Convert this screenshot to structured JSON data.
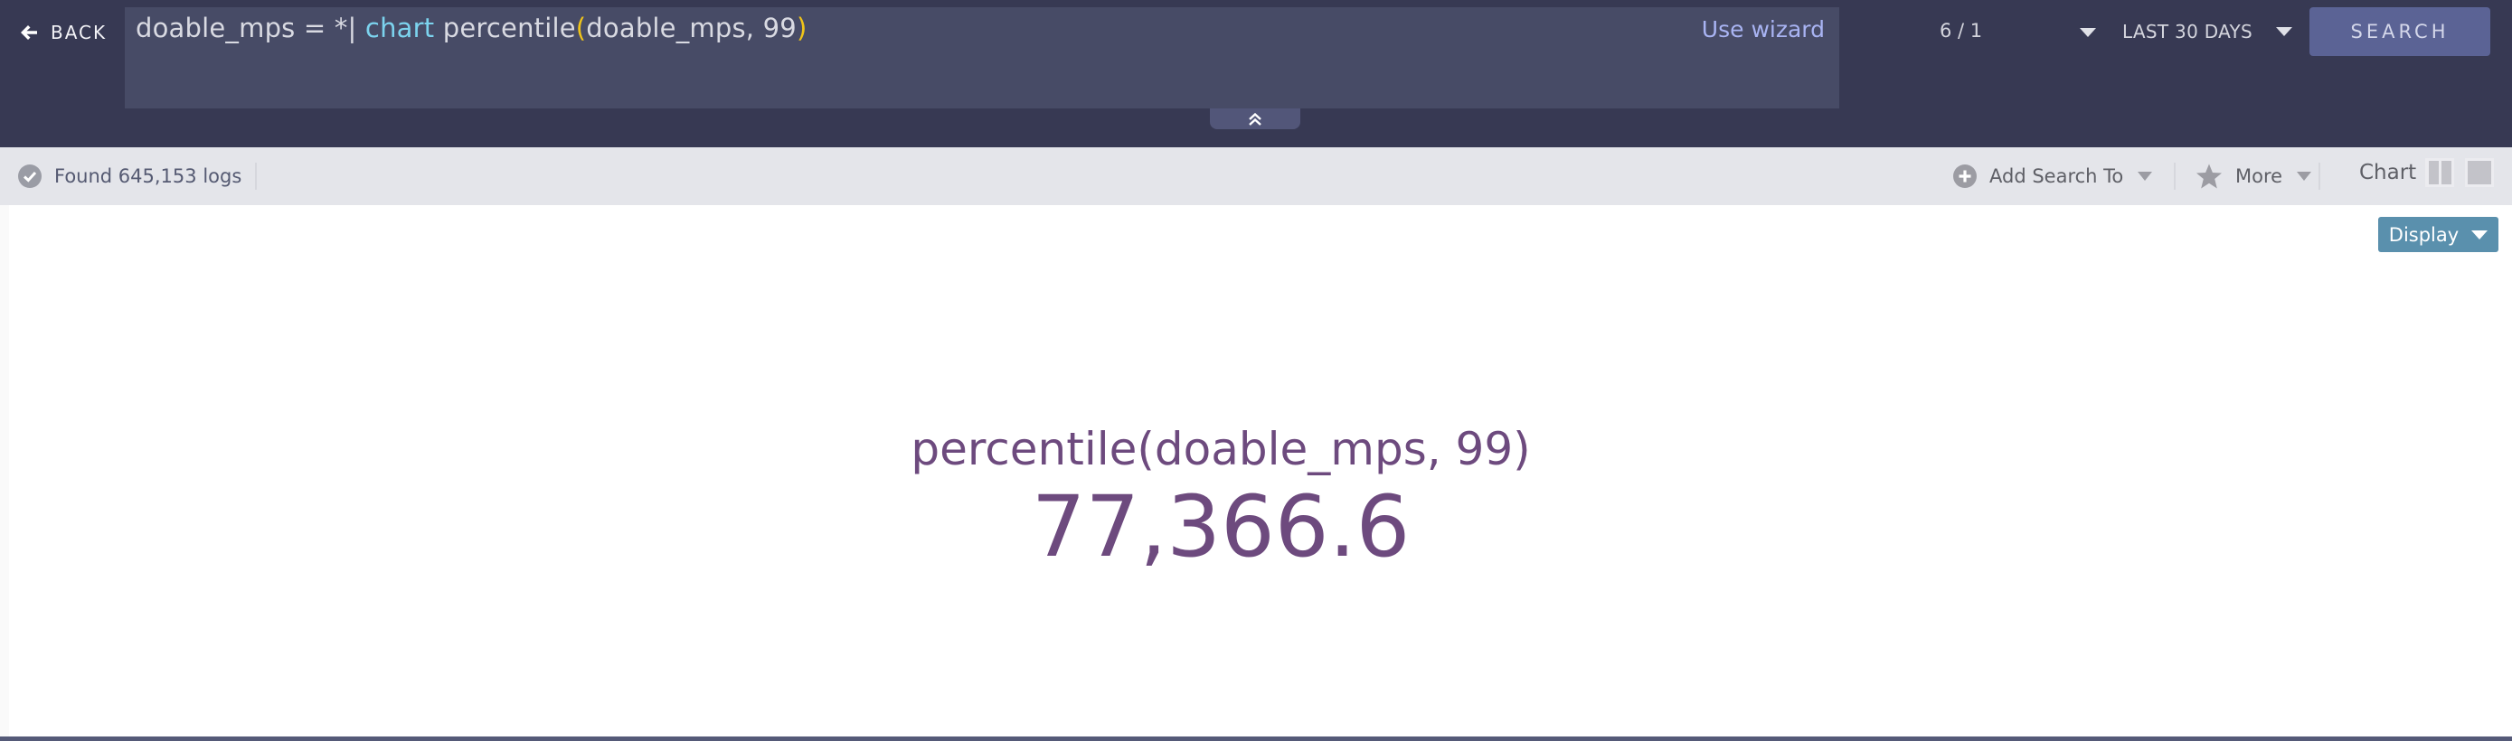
{
  "header": {
    "back_label": "BACK",
    "query": {
      "segments": {
        "s0": "doable_mps = *",
        "s1": "|",
        "s2": " chart",
        "s3": " percentile",
        "s4": "(",
        "s5": "doable_mps, 99",
        "s6": ")"
      },
      "keyword_color": "#7cd3ee",
      "paren_color": "#f0c419"
    },
    "use_wizard_label": "Use wizard",
    "page_count": "6 / 1",
    "time_range": "LAST 30 DAYS",
    "search_label": "SEARCH",
    "collapse_icon": "double-chevron-up-icon"
  },
  "toolbar": {
    "status_icon": "check-circle-icon",
    "found_text": "Found 645,153 logs",
    "add_search_label": "Add Search To",
    "add_search_icon": "plus-circle-icon",
    "more_label": "More",
    "more_icon": "star-icon",
    "chart_label": "Chart",
    "view_toggles": [
      "split-view-icon",
      "single-view-icon"
    ]
  },
  "content": {
    "display_label": "Display",
    "metric": {
      "label": "percentile(doable_mps, 99)",
      "value": "77,366.6"
    }
  },
  "colors": {
    "header_bg": "#373953",
    "query_bg": "#474b66",
    "search_button": "#5b6395",
    "toolbar_bg": "#e4e5ea",
    "display_button": "#5a90ad",
    "metric_text": "#6d4a7e",
    "wizard_link": "#a9b4f3"
  }
}
